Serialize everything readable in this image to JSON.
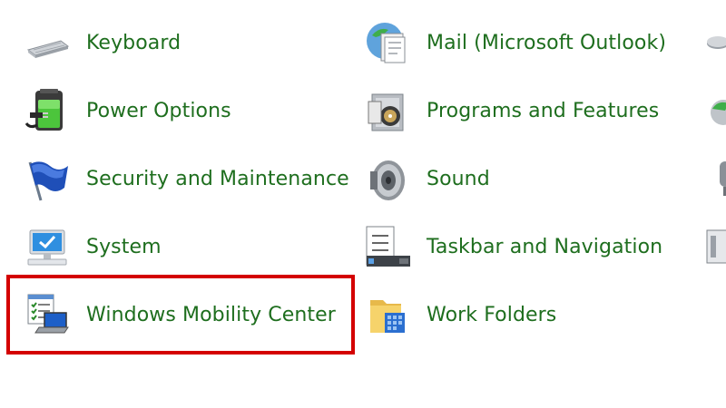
{
  "control_panel": {
    "column_1": [
      {
        "label": "Keyboard",
        "icon": "keyboard-icon"
      },
      {
        "label": "Power Options",
        "icon": "power-options-icon"
      },
      {
        "label": "Security and Maintenance",
        "icon": "security-flag-icon"
      },
      {
        "label": "System",
        "icon": "system-monitor-icon"
      },
      {
        "label": "Windows Mobility Center",
        "icon": "mobility-center-icon"
      }
    ],
    "column_2": [
      {
        "label": "Mail (Microsoft Outlook)",
        "icon": "mail-icon"
      },
      {
        "label": "Programs and Features",
        "icon": "programs-features-icon"
      },
      {
        "label": "Sound",
        "icon": "speaker-icon"
      },
      {
        "label": "Taskbar and Navigation",
        "icon": "taskbar-icon"
      },
      {
        "label": "Work Folders",
        "icon": "work-folders-icon"
      }
    ],
    "highlighted_item": "Windows Mobility Center",
    "colors": {
      "link_text": "#1e6e1e",
      "highlight_border": "#d40000",
      "background": "#ffffff"
    }
  }
}
